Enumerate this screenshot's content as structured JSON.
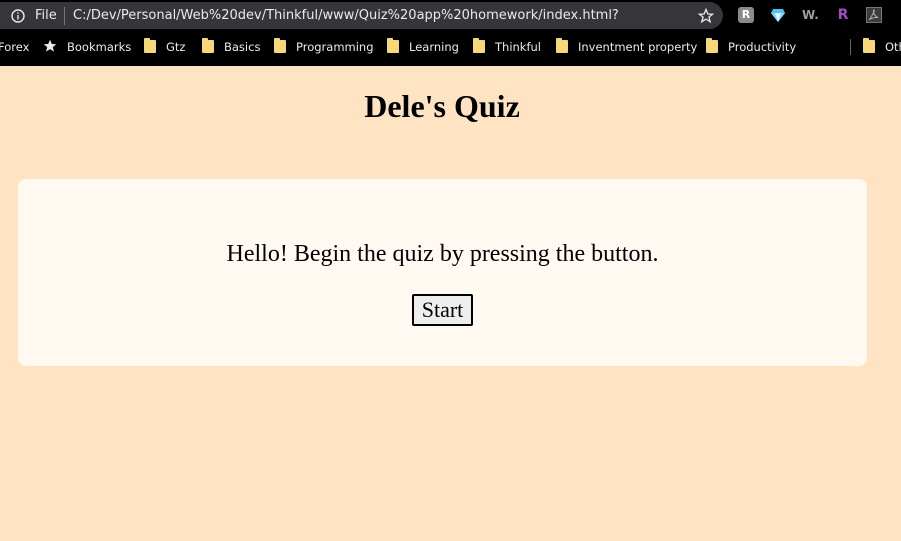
{
  "browser": {
    "scheme_label": "File",
    "url": "C:/Dev/Personal/Web%20dev/Thinkful/www/Quiz%20app%20homework/index.html?",
    "extensions": [
      "reddit-enhancement-icon",
      "gem-icon",
      "w-icon",
      "r-icon",
      "pdf-icon"
    ],
    "extension_labels": {
      "r1": "R",
      "w": "W.",
      "r2": "R"
    }
  },
  "bookmarks": {
    "items": [
      {
        "label": "Forex",
        "icon": "none"
      },
      {
        "label": "Bookmarks",
        "icon": "star-icon"
      },
      {
        "label": "Gtz",
        "icon": "folder-icon"
      },
      {
        "label": "Basics",
        "icon": "folder-icon"
      },
      {
        "label": "Programming",
        "icon": "folder-icon"
      },
      {
        "label": "Learning",
        "icon": "folder-icon"
      },
      {
        "label": "Thinkful",
        "icon": "folder-icon"
      },
      {
        "label": "Inventment property",
        "icon": "folder-icon"
      },
      {
        "label": "Productivity",
        "icon": "folder-icon"
      },
      {
        "label": "Oth",
        "icon": "folder-icon"
      }
    ]
  },
  "page": {
    "title": "Dele's Quiz",
    "prompt": "Hello! Begin the quiz by pressing the button.",
    "start_label": "Start"
  },
  "colors": {
    "background": "#ffe4c4",
    "card": "#fff9f2",
    "chrome": "#000000",
    "omnibox": "#35363a",
    "folder": "#f6d87a"
  }
}
